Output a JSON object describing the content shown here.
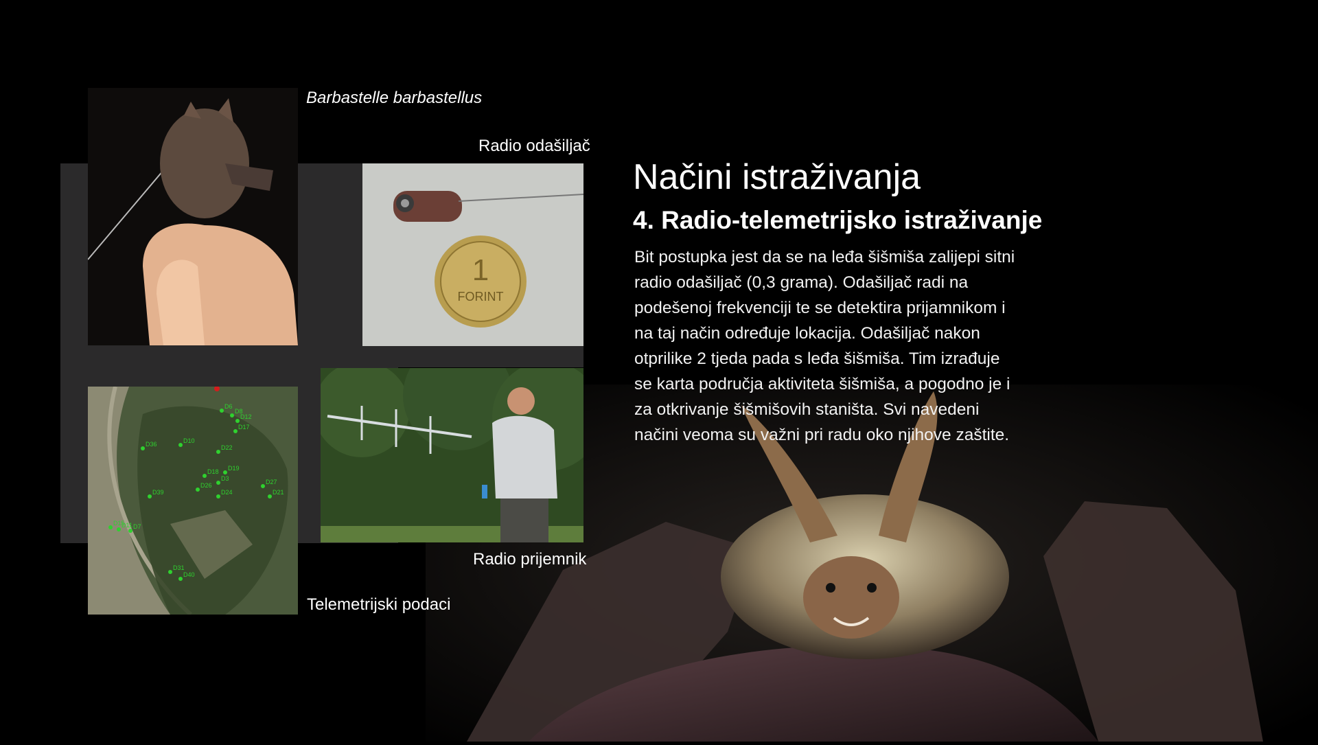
{
  "slide": {
    "title": "Načini istraživanja",
    "subtitle": "4. Radio-telemetrijsko istraživanje",
    "body_lines": [
      "Bit postupka jest da se na leđa šišmiša zalijepi sitni",
      "radio odašiljač (0,3 grama). Odašiljač radi na",
      "podešenoj frekvenciji te se detektira prijamnikom i",
      "na taj način određuje lokacija. Odašiljač nakon",
      "otprilike 2 tjeda pada s leđa šišmiša. Tim izrađuje",
      "se karta područja aktiviteta šišmiša, a pogodno je i",
      "za otkrivanje šišmišovih staništa. Svi navedeni",
      "načini veoma su važni pri radu oko njihove zaštite."
    ]
  },
  "captions": {
    "bat_species": "Barbastelle barbastellus",
    "transmitter": "Radio odašiljač",
    "receiver": "Radio prijemnik",
    "telemetry": "Telemetrijski podaci"
  },
  "map_points": [
    "D6",
    "D8",
    "D12",
    "D17",
    "D36",
    "D10",
    "D22",
    "D19",
    "D18",
    "D3",
    "D27",
    "D26",
    "D24",
    "D21",
    "D39",
    "D15",
    "D11",
    "D7",
    "D31",
    "D40"
  ],
  "coin_text": "FORINT",
  "colors": {
    "background": "#000000",
    "panel": "#2b2a2b",
    "text": "#ffffff",
    "map_point": "#2fd12f"
  }
}
